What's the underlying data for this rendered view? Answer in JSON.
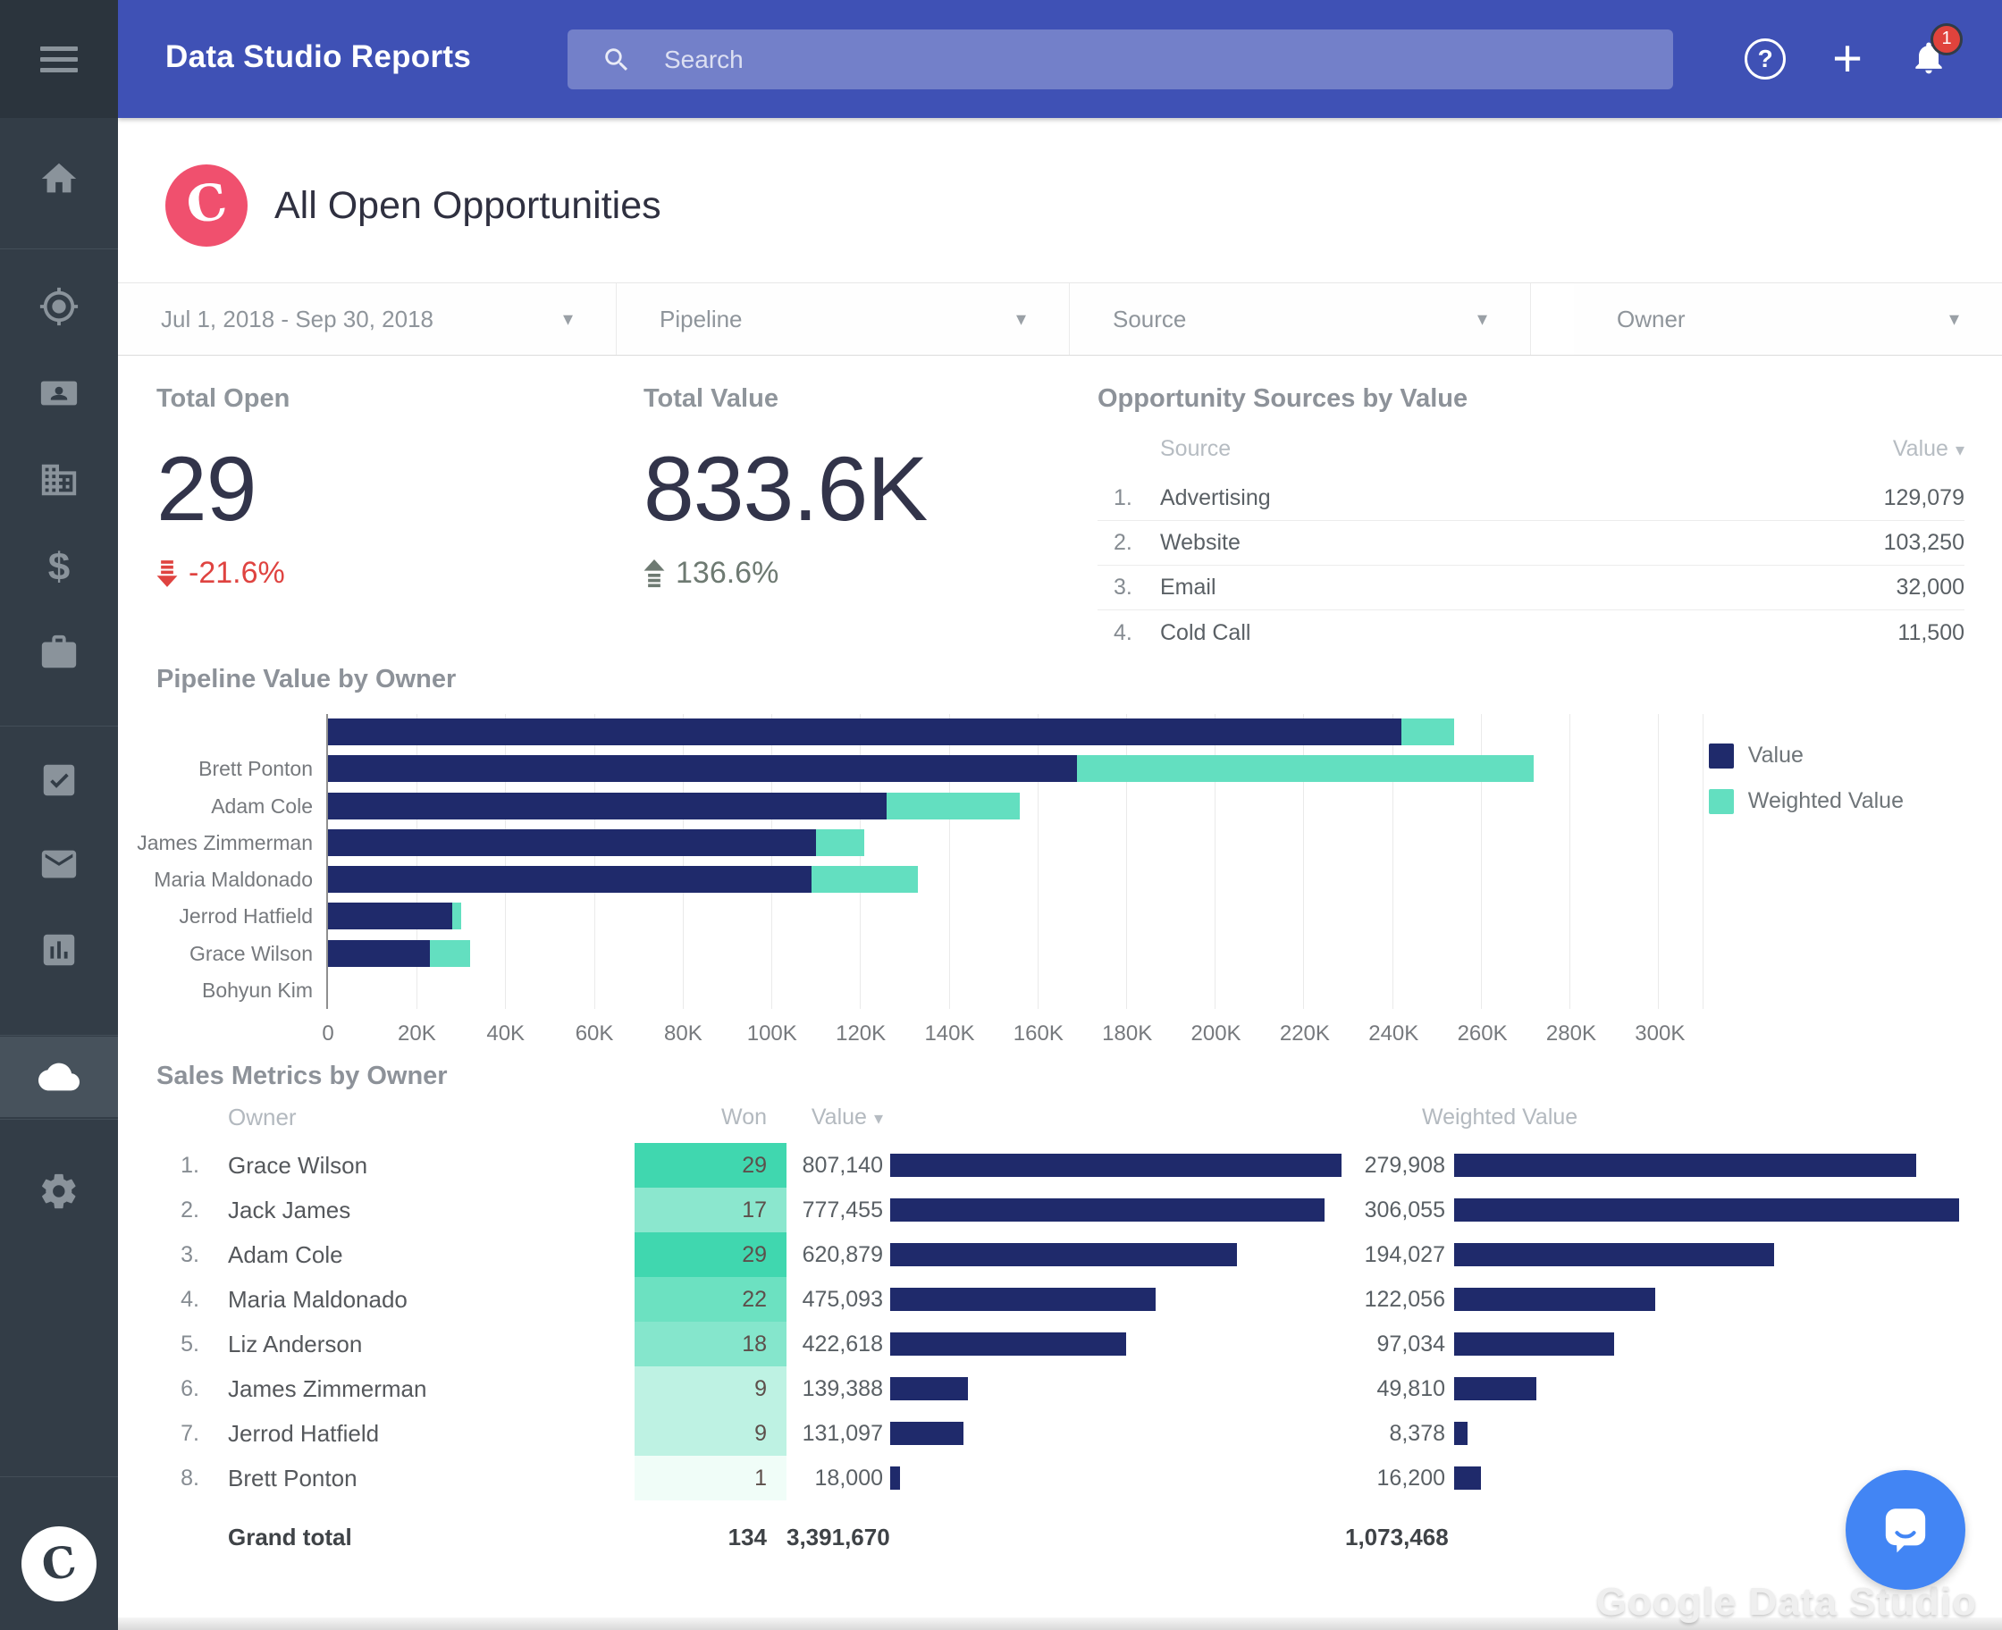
{
  "topbar": {
    "app_title": "Data Studio Reports",
    "search_placeholder": "Search",
    "notification_count": "1"
  },
  "sidebar": {
    "icons": [
      "menu",
      "home",
      "target",
      "contact-card",
      "company",
      "dollar",
      "briefcase",
      "tasks",
      "mail",
      "chart",
      "cloud",
      "settings",
      "copper-logo"
    ],
    "active_item": "cloud"
  },
  "report": {
    "title": "All Open Opportunities"
  },
  "filters": [
    {
      "label": "Jul 1, 2018 - Sep 30, 2018"
    },
    {
      "label": "Pipeline"
    },
    {
      "label": "Source"
    },
    {
      "label": "Owner"
    }
  ],
  "scorecards": [
    {
      "label": "Total Open",
      "value": "29",
      "delta": "-21.6%",
      "direction": "down"
    },
    {
      "label": "Total Value",
      "value": "833.6K",
      "delta": "136.6%",
      "direction": "up"
    }
  ],
  "sources_table": {
    "title": "Opportunity Sources by Value",
    "col_source": "Source",
    "col_value": "Value",
    "rows": [
      {
        "rank": "1.",
        "source": "Advertising",
        "value": "129,079"
      },
      {
        "rank": "2.",
        "source": "Website",
        "value": "103,250"
      },
      {
        "rank": "3.",
        "source": "Email",
        "value": "32,000"
      },
      {
        "rank": "4.",
        "source": "Cold Call",
        "value": "11,500"
      }
    ]
  },
  "chart_data": {
    "type": "bar",
    "orientation": "horizontal",
    "stacked": true,
    "title": "Pipeline Value by Owner",
    "categories": [
      "",
      "Brett Ponton",
      "Adam Cole",
      "James Zimmerman",
      "Maria Maldonado",
      "Jerrod Hatfield",
      "Grace Wilson",
      "Bohyun Kim"
    ],
    "series": [
      {
        "name": "Value",
        "color": "#1f2a6b",
        "values": [
          242000,
          169000,
          126000,
          110000,
          109000,
          28000,
          23000,
          0
        ]
      },
      {
        "name": "Weighted Value",
        "color": "#63dfc0",
        "values": [
          12000,
          103000,
          30000,
          11000,
          24000,
          2000,
          9000,
          0
        ]
      }
    ],
    "xlim": [
      0,
      310000
    ],
    "x_tick_step": 20000,
    "x_ticks": [
      "0",
      "20K",
      "40K",
      "60K",
      "80K",
      "100K",
      "120K",
      "140K",
      "160K",
      "180K",
      "200K",
      "220K",
      "240K",
      "260K",
      "280K",
      "300K"
    ],
    "grid": "vertical",
    "legend_position": "top-right"
  },
  "sales_table": {
    "title": "Sales Metrics by Owner",
    "columns": [
      "Owner",
      "Won",
      "Value",
      "Weighted Value"
    ],
    "won_scale": {
      "min": 1,
      "max": 29,
      "min_color": "#f0fdf8",
      "max_color": "#40d7af"
    },
    "bar_color": "#1f2a6b",
    "rows": [
      {
        "rank": "1.",
        "owner": "Grace Wilson",
        "won": 29,
        "value": "807,140",
        "weighted": "279,908"
      },
      {
        "rank": "2.",
        "owner": "Jack James",
        "won": 17,
        "value": "777,455",
        "weighted": "306,055"
      },
      {
        "rank": "3.",
        "owner": "Adam Cole",
        "won": 29,
        "value": "620,879",
        "weighted": "194,027"
      },
      {
        "rank": "4.",
        "owner": "Maria Maldonado",
        "won": 22,
        "value": "475,093",
        "weighted": "122,056"
      },
      {
        "rank": "5.",
        "owner": "Liz Anderson",
        "won": 18,
        "value": "422,618",
        "weighted": "97,034"
      },
      {
        "rank": "6.",
        "owner": "James Zimmerman",
        "won": 9,
        "value": "139,388",
        "weighted": "49,810"
      },
      {
        "rank": "7.",
        "owner": "Jerrod Hatfield",
        "won": 9,
        "value": "131,097",
        "weighted": "8,378"
      },
      {
        "rank": "8.",
        "owner": "Brett Ponton",
        "won": 1,
        "value": "18,000",
        "weighted": "16,200"
      }
    ],
    "grand_total": {
      "label": "Grand total",
      "won": "134",
      "value": "3,391,670",
      "weighted": "1,073,468"
    }
  },
  "watermark": "Google Data Studio",
  "colors": {
    "header_blue": "#3f51b5",
    "sidebar_dark": "#333d47",
    "navy": "#1f2a6b",
    "teal": "#63dfc0",
    "red": "#df4340",
    "logo_pink": "#f0506e",
    "fab_blue": "#4285f4"
  }
}
